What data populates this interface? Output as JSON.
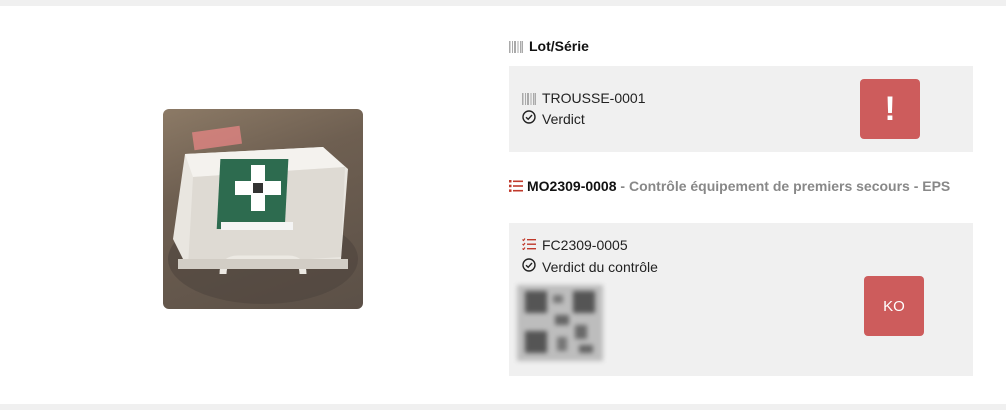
{
  "lot_serie": {
    "title": "Lot/Série",
    "serial": "TROUSSE-0001",
    "verdict_label": "Verdict",
    "alert_button_symbol": "!"
  },
  "order": {
    "reference": "MO2309-0008",
    "description": " - Contrôle équipement de premiers secours - EPS"
  },
  "control": {
    "reference": "FC2309-0005",
    "verdict_label": "Verdict du contrôle",
    "result_button": "KO"
  },
  "colors": {
    "danger": "#cd5c5c",
    "panel": "#f0f0f0",
    "list_icon": "#c0392b"
  },
  "icons": {
    "barcode": "barcode-icon",
    "check": "check-circle-icon",
    "list": "list-icon",
    "checklist": "checklist-icon",
    "exclamation": "exclamation-icon"
  }
}
